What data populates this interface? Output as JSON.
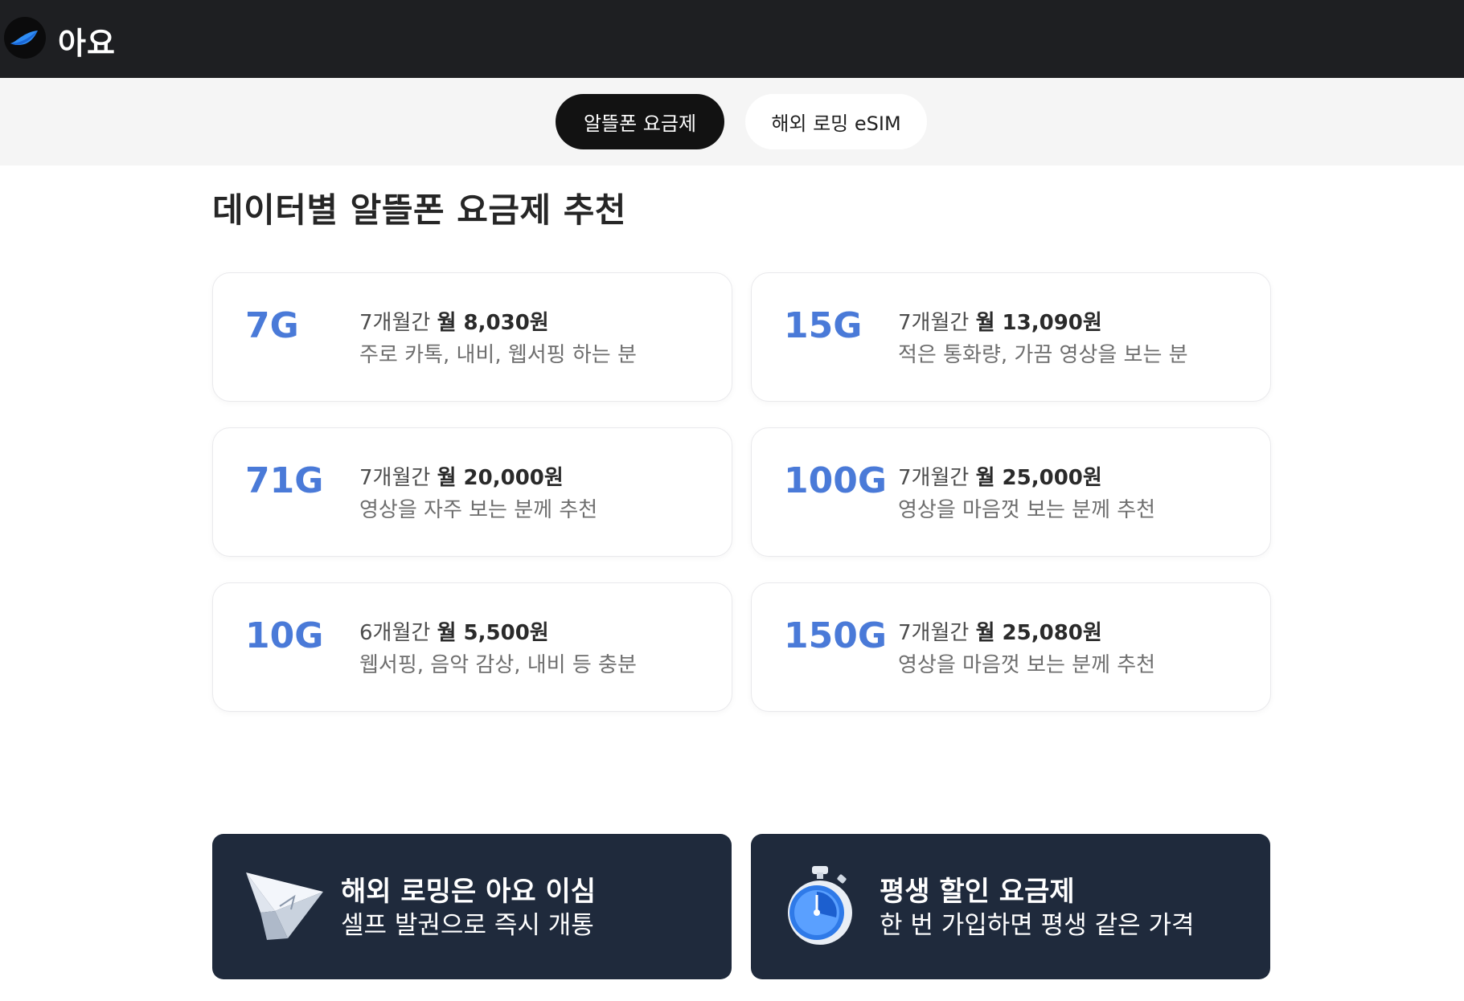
{
  "header": {
    "brand": "아요",
    "brand_color": "#1e1f22",
    "logo_icon": "wing-logo-icon"
  },
  "tabs": [
    {
      "label": "알뜰폰 요금제",
      "active": true
    },
    {
      "label": "해외 로밍 eSIM",
      "active": false
    }
  ],
  "section": {
    "title": "데이터별 알뜰폰 요금제 추천"
  },
  "plans": [
    {
      "data": "7G",
      "period": "7개월간",
      "price": "월 8,030원",
      "desc": "주로 카톡, 내비, 웹서핑 하는 분"
    },
    {
      "data": "15G",
      "period": "7개월간",
      "price": "월 13,090원",
      "desc": "적은 통화량, 가끔 영상을 보는 분"
    },
    {
      "data": "71G",
      "period": "7개월간",
      "price": "월 20,000원",
      "desc": "영상을 자주 보는 분께 추천"
    },
    {
      "data": "100G",
      "period": "7개월간",
      "price": "월 25,000원",
      "desc": "영상을 마음껏 보는 분께 추천"
    },
    {
      "data": "10G",
      "period": "6개월간",
      "price": "월 5,500원",
      "desc": "웹서핑, 음악 감상, 내비 등 충분"
    },
    {
      "data": "150G",
      "period": "7개월간",
      "price": "월 25,080원",
      "desc": "영상을 마음껏 보는 분께 추천"
    }
  ],
  "promos": [
    {
      "title": "해외 로밍은 아요 이심",
      "subtitle": "셀프 발권으로 즉시 개통",
      "icon": "paper-plane-icon"
    },
    {
      "title": "평생 할인 요금제",
      "subtitle": "한 번 가입하면 평생 같은 가격",
      "icon": "stopwatch-icon"
    }
  ],
  "colors": {
    "accent_blue": "#4a7ad8",
    "promo_bg": "#1f2a3c",
    "tab_active_bg": "#121212"
  }
}
